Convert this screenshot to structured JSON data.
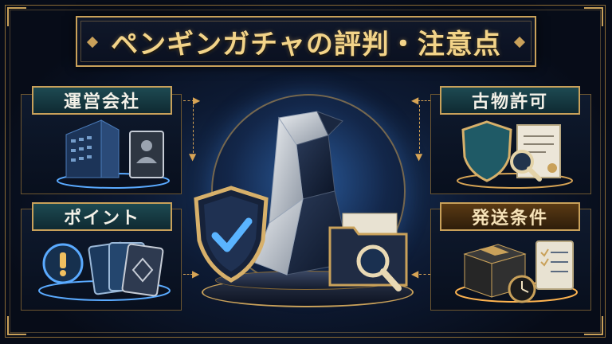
{
  "title": "ペンギンガチャの評判・注意点",
  "panels": {
    "company": {
      "label": "運営会社"
    },
    "license": {
      "label": "古物許可"
    },
    "points": {
      "label": "ポイント"
    },
    "shipping": {
      "label": "発送条件"
    }
  },
  "colors": {
    "gold": "#c9a15a",
    "teal": "#1d4a52",
    "background": "#070c18",
    "glow_blue": "#5aaaff",
    "glow_orange": "#ffb450"
  },
  "icons": [
    "building-icon",
    "id-card-icon",
    "shield-icon",
    "certificate-icon",
    "magnifier-icon",
    "lightbulb-icon",
    "card-stack-icon",
    "penguin-icon",
    "shield-check-icon",
    "folder-search-icon",
    "package-box-icon",
    "clock-icon",
    "checklist-icon"
  ]
}
